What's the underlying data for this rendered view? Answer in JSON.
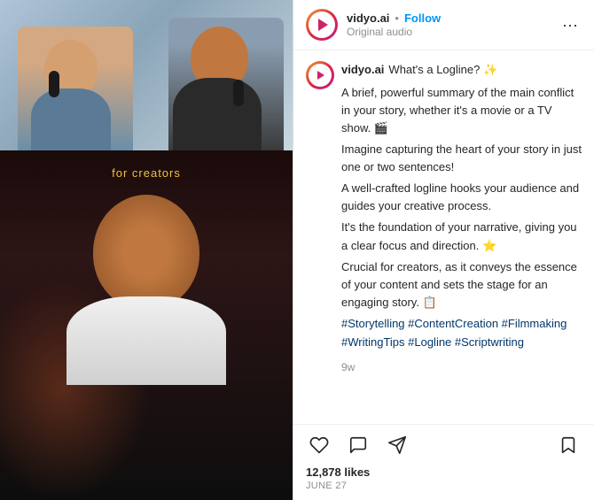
{
  "post": {
    "username": "vidyo.ai",
    "follow_label": "Follow",
    "dot_separator": "•",
    "original_audio": "Original audio",
    "more_icon": "···",
    "video_label": "for creators",
    "caption": {
      "username": "vidyo.ai",
      "title": "What's a Logline? ✨",
      "body_lines": [
        "A brief, powerful summary of the main conflict in your story, whether it's a movie or a TV show. 🎬",
        "Imagine capturing the heart of your story in just one or two sentences!",
        "A well-crafted logline hooks your audience and guides your creative process.",
        "It's the foundation of your narrative, giving you a clear focus and direction. ⭐",
        "Crucial for creators, as it conveys the essence of your content and sets the stage for an engaging story. 📋"
      ],
      "hashtags": "#Storytelling #ContentCreation #Filmmaking #WritingTips #Logline #Scriptwriting",
      "time_ago": "9w"
    },
    "likes": "12,878 likes",
    "date": "June 27",
    "actions": {
      "like_icon": "heart",
      "comment_icon": "comment",
      "share_icon": "share",
      "save_icon": "bookmark"
    }
  }
}
